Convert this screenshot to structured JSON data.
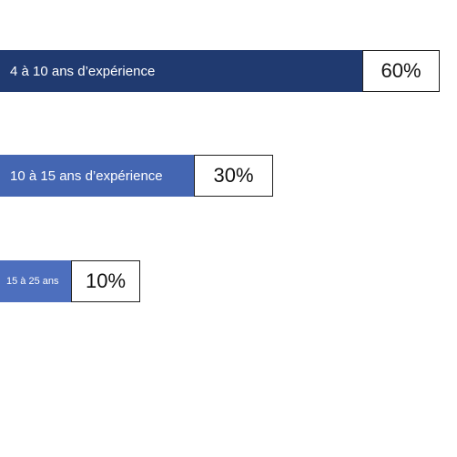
{
  "chart_data": {
    "type": "bar",
    "orientation": "horizontal",
    "categories": [
      "4 à 10 ans d’expérience",
      "10 à 15 ans d’expérience",
      "15 à 25 ans"
    ],
    "values": [
      60,
      30,
      10
    ],
    "value_labels": [
      "60%",
      "30%",
      "10%"
    ],
    "colors": [
      "#203a70",
      "#4466b2",
      "#4d6fbe"
    ],
    "legend": "none",
    "grid": false
  }
}
